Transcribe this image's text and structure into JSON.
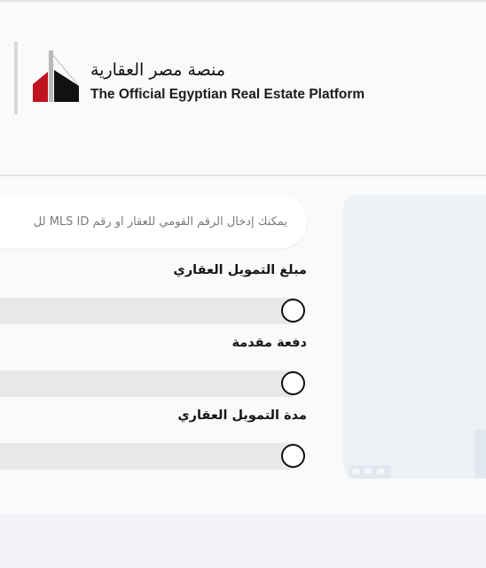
{
  "header": {
    "logo_arabic": "منصة مصر العقارية",
    "logo_english": "The Official Egyptian Real Estate Platform",
    "logo_icon": "building-logo-icon",
    "colors": {
      "red": "#c1121f",
      "black": "#111111"
    }
  },
  "search": {
    "placeholder": "يمكنك إدخال الرقم القومي للعقار او رقم MLS ID لل"
  },
  "fields": [
    {
      "label": "مبلغ التمويل العقاري"
    },
    {
      "label": "دفعة مقدمة"
    },
    {
      "label": "مدة التمويل العقاري"
    }
  ]
}
